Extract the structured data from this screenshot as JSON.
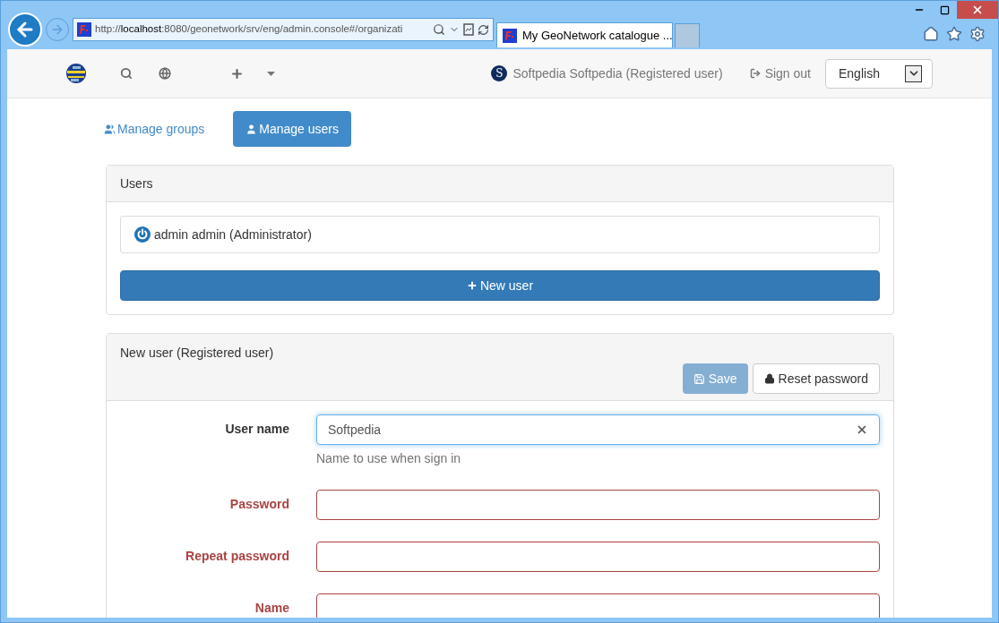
{
  "browser": {
    "address": "http://**localhost**:8080/geonetwork/srv/eng/admin.console#/organizati",
    "tabs": [
      {
        "title": "My GeoNetwork catalogue ...",
        "selected": true
      }
    ]
  },
  "navbar": {
    "avatar_letter": "S",
    "user": "Softpedia Softpedia (Registered user)",
    "sign_out": "Sign out",
    "language": "English"
  },
  "tabs": [
    {
      "label": "Manage groups",
      "selected": false,
      "kind": "groups"
    },
    {
      "label": "Manage users",
      "selected": true,
      "kind": "user"
    }
  ],
  "users_panel": {
    "title": "Users",
    "users": [
      {
        "name": "admin admin (Administrator)"
      }
    ],
    "new_user_button": "New user"
  },
  "form_panel": {
    "title": "New user (Registered user)",
    "save": {
      "label": "Save",
      "disabled": true
    },
    "reset_password": "Reset password",
    "fields": [
      {
        "label": "User name",
        "value": "Softpedia",
        "hint": "Name to use when sign in",
        "invalid": false,
        "focused": true
      },
      {
        "label": "Password",
        "invalid": true,
        "focused": false
      },
      {
        "label": "Repeat password",
        "invalid": true,
        "focused": false
      },
      {
        "label": "Name",
        "invalid": true,
        "focused": false
      }
    ]
  }
}
